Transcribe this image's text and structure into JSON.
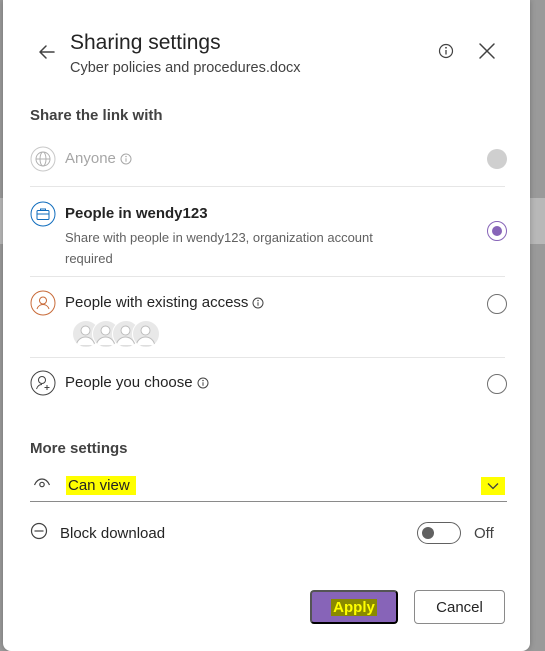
{
  "dialog": {
    "title": "Sharing settings",
    "subtitle": "Cyber policies and procedures.docx"
  },
  "share_section": {
    "heading": "Share the link with",
    "options": [
      {
        "label": "Anyone",
        "icon": "globe-icon",
        "has_info": true,
        "state": "disabled"
      },
      {
        "label": "People in wendy123",
        "description": "Share with people in wendy123, organization account required",
        "icon": "organization-icon",
        "state": "selected"
      },
      {
        "label": "People with existing access",
        "icon": "person-circle-icon",
        "has_info": true,
        "state": "unselected"
      },
      {
        "label": "People you choose",
        "icon": "person-add-icon",
        "has_info": true,
        "state": "unselected"
      }
    ]
  },
  "more_settings": {
    "heading": "More settings",
    "permission": "Can view",
    "permission_icon": "eye-icon",
    "block_download_label": "Block download",
    "block_download_state": "Off"
  },
  "actions": {
    "apply": "Apply",
    "cancel": "Cancel"
  },
  "colors": {
    "accent": "#8764b8",
    "highlight": "#ffff00"
  }
}
